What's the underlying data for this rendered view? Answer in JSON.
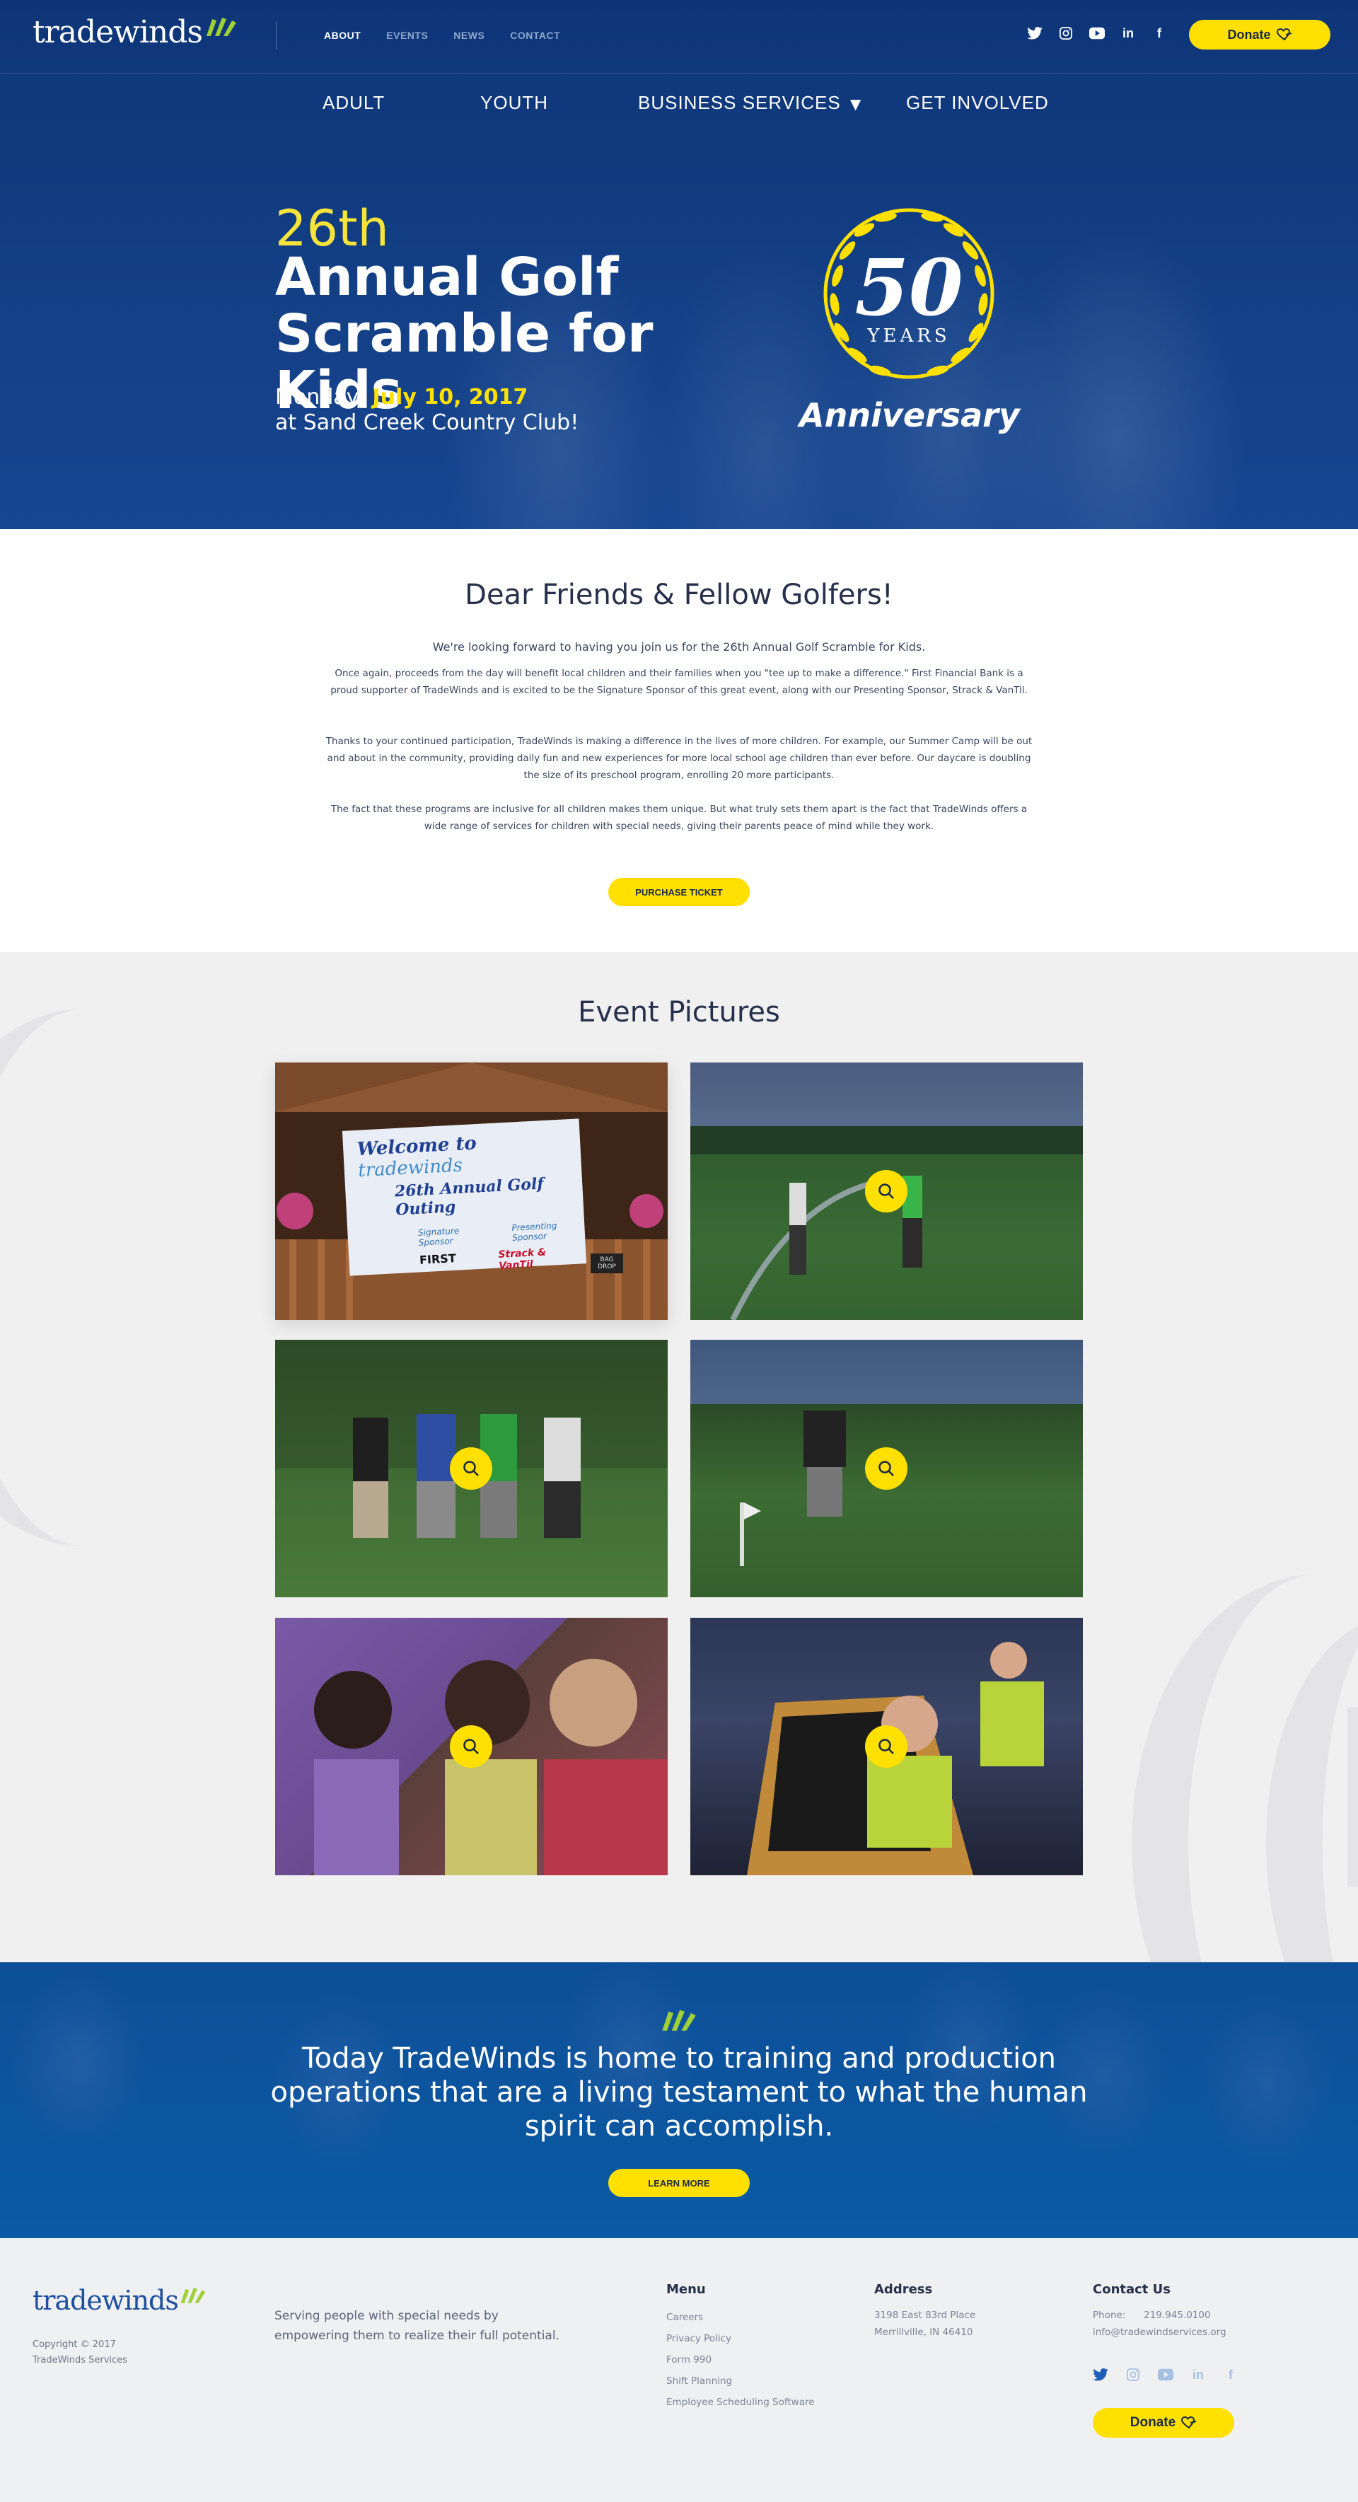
{
  "brand": {
    "logo_text": "tradewinds",
    "accent": "#ffe000",
    "navy": "#103d82"
  },
  "topnav": [
    {
      "label": "ABOUT",
      "active": true
    },
    {
      "label": "EVENTS",
      "active": false
    },
    {
      "label": "NEWS",
      "active": false
    },
    {
      "label": "CONTACT",
      "active": false
    }
  ],
  "social": [
    "twitter-icon",
    "instagram-icon",
    "youtube-icon",
    "linkedin-icon",
    "facebook-icon"
  ],
  "donate_label": "Donate",
  "mainnav": [
    "ADULT",
    "YOUTH",
    "BUSINESS SERVICES",
    "GET INVOLVED"
  ],
  "hero": {
    "number": "26th",
    "title": "Annual Golf Scramble for Kids",
    "date_prefix": "Monday,",
    "date": "July 10, 2017",
    "venue": "at Sand Creek Country Club!",
    "badge_number": "50",
    "badge_years": "YEARS",
    "badge_caption": "Anniversary"
  },
  "letter": {
    "title": "Dear Friends & Fellow Golfers!",
    "lead": "We're looking forward to having you join us for the 26th Annual Golf Scramble for Kids.",
    "p1": "Once again, proceeds from the day will benefit local children and their families when you \"tee up to make a difference.\" First Financial Bank is a proud supporter of TradeWinds and is excited to be the Signature Sponsor of this great event, along with our Presenting Sponsor, Strack & VanTil.",
    "p2": "Thanks to your continued participation, TradeWinds is making a difference in the lives of more children. For example, our Summer Camp will be out and about in the community, providing daily fun and new experiences for more local school age children than ever before. Our daycare is doubling the size of its preschool program, enrolling 20 more participants.",
    "p3": "The fact that these programs are inclusive for all children makes them unique. But what truly sets them apart is the fact that TradeWinds offers a wide range of services for children with special needs, giving their parents peace of mind while they work.",
    "button": "PURCHASE TICKET"
  },
  "gallery": {
    "title": "Event Pictures",
    "banner": {
      "welcome": "Welcome to",
      "brand": "tradewinds",
      "outing": "26th Annual Golf Outing",
      "sig": "Signature Sponsor",
      "first": "FIRST",
      "pres": "Presenting Sponsor",
      "strack": "Strack & VanTil",
      "bag": "BAG DROP"
    }
  },
  "cta": {
    "text": "Today TradeWinds is home to training and production operations that are a living testament to what the human spirit can accomplish.",
    "button": "LEARN MORE"
  },
  "footer": {
    "logo_text": "tradewinds",
    "copyright": "Copyright © 2017",
    "org": "TradeWinds Services",
    "tagline": "Serving people with special needs by empowering them to realize their full potential.",
    "menu_title": "Menu",
    "menu": [
      "Careers",
      "Privacy Policy",
      "Form 990",
      "Shift Planning",
      "Employee Scheduling Software"
    ],
    "address_title": "Address",
    "address1": "3198 East 83rd Place",
    "address2": "Merrillville, IN 46410",
    "contact_title": "Contact Us",
    "phone_label": "Phone:",
    "phone": "219.945.0100",
    "email": "info@tradewindservices.org",
    "donate": "Donate"
  }
}
